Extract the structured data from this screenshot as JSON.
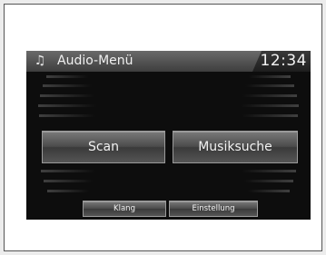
{
  "header": {
    "title": "Audio-Menü",
    "clock": "12:34",
    "icon": "music-note-icon"
  },
  "main_buttons": [
    {
      "label": "Scan"
    },
    {
      "label": "Musiksuche"
    }
  ],
  "bottom_buttons": [
    {
      "label": "Klang"
    },
    {
      "label": "Einstellung"
    }
  ],
  "colors": {
    "background": "#0d0d0d",
    "titlebar": "#5a5a5a",
    "button": "#555555",
    "text": "#f2f2f2"
  }
}
